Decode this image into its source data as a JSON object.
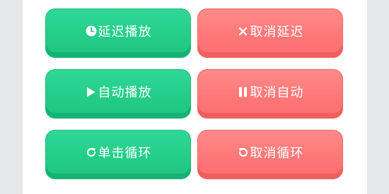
{
  "buttons": {
    "delay_play": {
      "label": "延迟播放",
      "icon": "clock-icon",
      "color": "#23cc87"
    },
    "cancel_delay": {
      "label": "取消延迟",
      "icon": "close-icon",
      "color": "#ff7676"
    },
    "auto_play": {
      "label": "自动播放",
      "icon": "play-icon",
      "color": "#23cc87"
    },
    "cancel_auto": {
      "label": "取消自动",
      "icon": "pause-icon",
      "color": "#ff7676"
    },
    "single_loop": {
      "label": "单击循环",
      "icon": "redo-icon",
      "color": "#23cc87"
    },
    "cancel_loop": {
      "label": "取消循环",
      "icon": "undo-icon",
      "color": "#ff7676"
    }
  }
}
